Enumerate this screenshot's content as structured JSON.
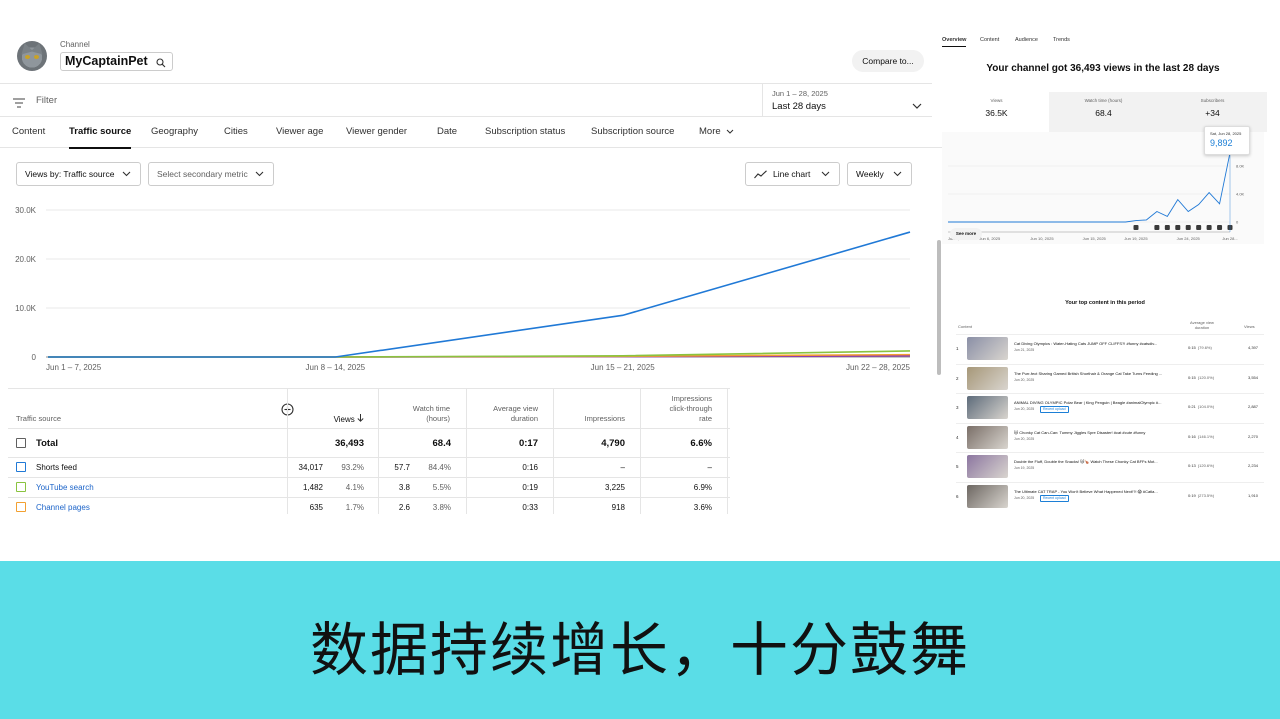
{
  "channel": {
    "caption": "Channel",
    "name": "MyCaptainPet"
  },
  "compare_label": "Compare to...",
  "filter_placeholder": "Filter",
  "date_range": {
    "range": "Jun 1 – 28, 2025",
    "label": "Last 28 days"
  },
  "tabs": [
    "Content",
    "Traffic source",
    "Geography",
    "Cities",
    "Viewer age",
    "Viewer gender",
    "Date",
    "Subscription status",
    "Subscription source",
    "More"
  ],
  "active_tab": "Traffic source",
  "controls": {
    "primary_metric": "Views by: Traffic source",
    "secondary_metric": "Select secondary metric",
    "chart_type": "Line chart",
    "interval": "Weekly"
  },
  "chart_data": {
    "type": "line",
    "categories": [
      "Jun 1 – 7, 2025",
      "Jun 8 – 14, 2025",
      "Jun 15 – 21, 2025",
      "Jun 22 – 28, 2025"
    ],
    "y_ticks": [
      "0",
      "10.0K",
      "20.0K",
      "30.0K"
    ],
    "ylim": [
      0,
      30000
    ],
    "grid": true,
    "series": [
      {
        "name": "Shorts feed",
        "color": "#2079d6",
        "values": [
          0,
          0,
          8500,
          25500
        ]
      },
      {
        "name": "YouTube search",
        "color": "#8ac33f",
        "values": [
          0,
          0,
          250,
          1232
        ]
      },
      {
        "name": "Channel pages",
        "color": "#f2a031",
        "values": [
          0,
          0,
          150,
          485
        ]
      },
      {
        "color": "#8e2db5",
        "values": [
          0,
          0,
          80,
          260
        ]
      }
    ]
  },
  "table": {
    "headers": {
      "source": "Traffic source",
      "views": "Views",
      "watch_time": [
        "Watch time",
        "(hours)"
      ],
      "avg_duration": [
        "Average view",
        "duration"
      ],
      "impressions": "Impressions",
      "ctr": [
        "Impressions",
        "click-through",
        "rate"
      ]
    },
    "total": {
      "label": "Total",
      "views": "36,493",
      "watch": "68.4",
      "avg": "0:17",
      "impressions": "4,790",
      "ctr": "6.6%"
    },
    "rows": [
      {
        "label": "Shorts feed",
        "color": "#2079d6",
        "views": "34,017",
        "views_pct": "93.2%",
        "watch": "57.7",
        "watch_pct": "84.4%",
        "avg": "0:16",
        "impressions": "–",
        "ctr": "–"
      },
      {
        "label": "YouTube search",
        "color": "#8ac33f",
        "views": "1,482",
        "views_pct": "4.1%",
        "watch": "3.8",
        "watch_pct": "5.5%",
        "avg": "0:19",
        "impressions": "3,225",
        "ctr": "6.9%"
      },
      {
        "label": "Channel pages",
        "color": "#f2a031",
        "views": "635",
        "views_pct": "1.7%",
        "watch": "2.6",
        "watch_pct": "3.8%",
        "avg": "0:33",
        "impressions": "918",
        "ctr": "3.6%"
      }
    ]
  },
  "overview": {
    "tabs": [
      "Overview",
      "Content",
      "Audience",
      "Trends"
    ],
    "headline": "Your channel got 36,493 views in the last 28 days",
    "metrics": [
      {
        "label": "Views",
        "value": "36.5K"
      },
      {
        "label": "Watch time (hours)",
        "value": "68.4"
      },
      {
        "label": "Subscribers",
        "value": "+34"
      }
    ],
    "mini_chart": {
      "type": "line",
      "x_ticks": [
        "Jun 1, 2025",
        "Jun 6, 2025",
        "Jun 10, 2025",
        "Jun 15, 2025",
        "Jun 19, 2025",
        "Jun 24, 2025",
        "Jun 28..."
      ],
      "y_ticks": [
        "0",
        "4.0K",
        "8.0K"
      ],
      "values": [
        0,
        0,
        0,
        0,
        0,
        0,
        0,
        0,
        0,
        0,
        0,
        0,
        0,
        0,
        0,
        0,
        0,
        0,
        200,
        300,
        1500,
        800,
        3200,
        1500,
        2500,
        4200,
        2600,
        9892
      ],
      "color": "#2079d6",
      "tooltip": {
        "date": "Sat, Jun 28, 2025",
        "value": "9,892"
      }
    },
    "see_more": "See more",
    "top_content_title": "Your top content in this period",
    "top_content_headers": {
      "content": "Content",
      "avg": [
        "Average view",
        "duration"
      ],
      "views": "Views"
    },
    "top_content": [
      {
        "rank": "1",
        "title": "Cat Diving Olympics : Water-Hating Cats JUMP OFF CLIFFS?! #funny #catsdiv...",
        "date": "Jun 21, 2025",
        "badge": "",
        "duration": "0:15",
        "pct": "(79.6%)",
        "views": "4,397",
        "thumb": "#8a8fa6"
      },
      {
        "rank": "2",
        "title": "The Purr-fect Sharing Gamed British Shorthair & Orange Cat Take Turns Feeding ...",
        "date": "Jun 20, 2025",
        "badge": "",
        "duration": "0:15",
        "pct": "(120.0%)",
        "views": "3,554",
        "thumb": "#a69778"
      },
      {
        "rank": "3",
        "title": "ANIMAL DIVING OLYMPIC Polar Bear | King Penguin | Beagle #animalOlympic #...",
        "date": "Jun 20, 2025",
        "badge": "Recent upload",
        "duration": "0:21",
        "pct": "(104.0%)",
        "views": "2,887",
        "thumb": "#5d6b7a"
      },
      {
        "rank": "4",
        "title": "🐱 Chonky Cat Can-Can: Tummy Jiggles Spre Disaster! #cat #cute #funny",
        "date": "Jun 20, 2025",
        "badge": "",
        "duration": "0:16",
        "pct": "(146.1%)",
        "views": "2,270",
        "thumb": "#7a6f68"
      },
      {
        "rank": "5",
        "title": "Double the Fluff, Double the Snacks! 🐱🍗 Watch These Chonky Cat BFFs Mot...",
        "date": "Jun 19, 2025",
        "badge": "",
        "duration": "0:13",
        "pct": "(120.6%)",
        "views": "2,234",
        "thumb": "#8c76a0"
      },
      {
        "rank": "6",
        "title": "The Ultimate CAT TRAP - You Won't Believe What Happened Next!?! 😱 #Catla...",
        "date": "Jun 20, 2025",
        "badge": "Recent upload",
        "duration": "0:19",
        "pct": "(273.5%)",
        "views": "1,910",
        "thumb": "#6d6762"
      }
    ]
  },
  "caption_text": "数据持续增长，十分鼓舞"
}
